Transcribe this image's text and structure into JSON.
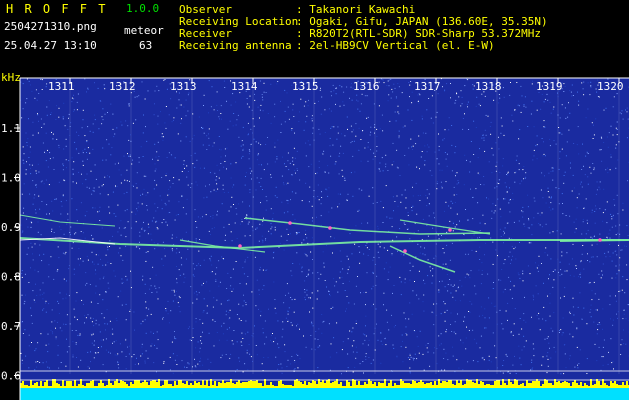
{
  "app": {
    "name": "H R O F F T",
    "version": "1.0.0"
  },
  "file": {
    "name": "2504271310.png",
    "datetime": "25.04.27 13:10"
  },
  "detection": {
    "label": "meteor",
    "count": "63"
  },
  "info": {
    "observer_label": "Observer",
    "observer_value": ": Takanori Kawachi",
    "location_label": "Receiving Location",
    "location_value": ": Ogaki, Gifu, JAPAN (136.60E, 35.35N)",
    "receiver_label": "Receiver",
    "receiver_value": ": R820T2(RTL-SDR) SDR-Sharp 53.372MHz",
    "antenna_label": "Receiving antenna",
    "antenna_value": ": 2el-HB9CV Vertical (el. E-W)"
  },
  "spectrogram": {
    "unit": "kHz",
    "time_ticks": [
      "1311",
      "1312",
      "1313",
      "1314",
      "1315",
      "1316",
      "1317",
      "1318",
      "1319",
      "1320"
    ],
    "freq_ticks": [
      "1.1",
      "1.0",
      "0.9",
      "0.8",
      "0.7",
      "0.6"
    ],
    "colors": {
      "bg": "#1a2ba0",
      "trace": "#7cf0a0",
      "peak": "#ff60c0",
      "level": "#00e0ff",
      "level_hi": "#ffff00"
    }
  }
}
